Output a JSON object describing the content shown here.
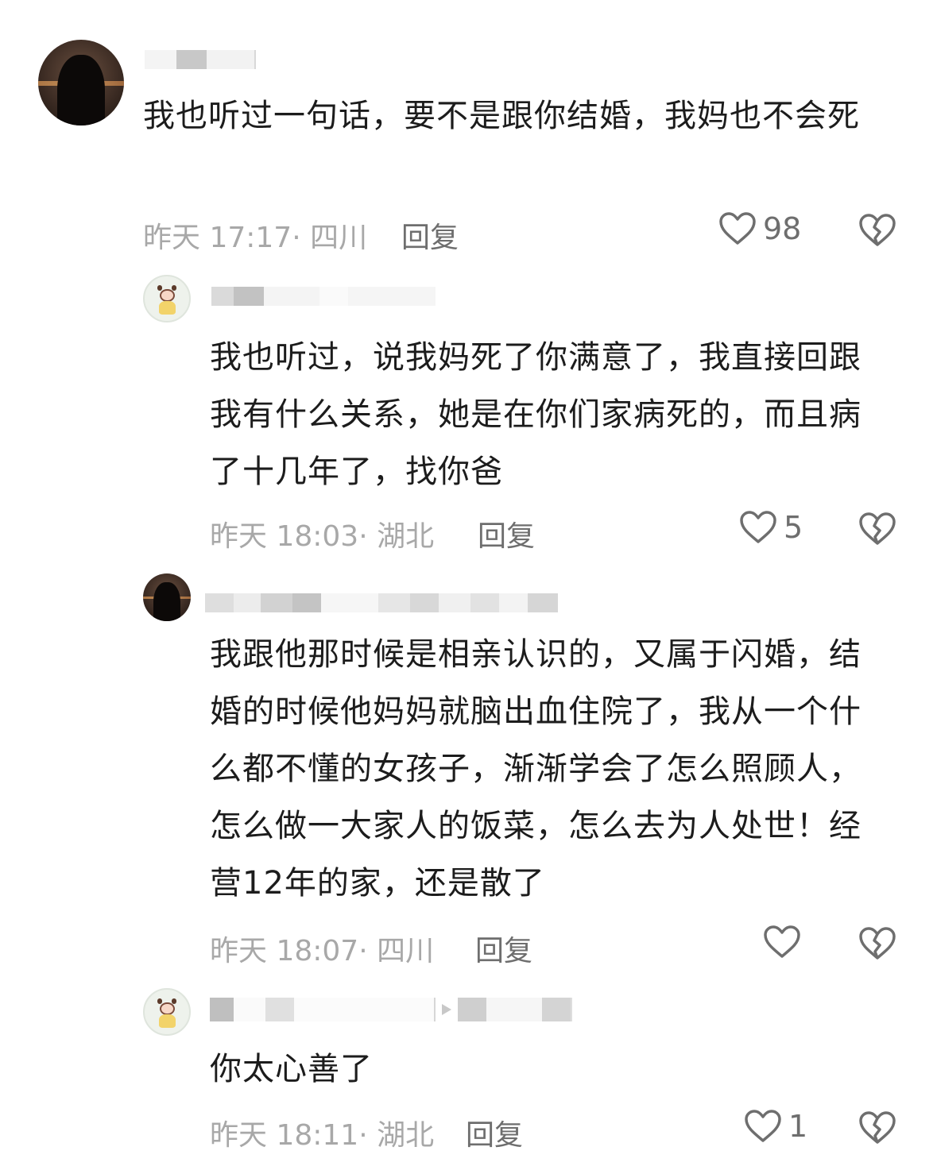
{
  "comments": [
    {
      "text": "我也听过一句话，要不是跟你结婚，我妈也不会死",
      "time": "昨天 17:17",
      "location": "四川",
      "reply_label": "回复",
      "likes": "98"
    },
    {
      "text": "我也听过，说我妈死了你满意了，我直接回跟我有什么关系，她是在你们家病死的，而且病了十几年了，找你爸",
      "time": "昨天 18:03",
      "location": "湖北",
      "reply_label": "回复",
      "likes": "5"
    },
    {
      "text": "我跟他那时候是相亲认识的，又属于闪婚，结婚的时候他妈妈就脑出血住院了，我从一个什么都不懂的女孩子，渐渐学会了怎么照顾人，怎么做一大家人的饭菜，怎么去为人处世！经营12年的家，还是散了",
      "time": "昨天 18:07",
      "location": "四川",
      "reply_label": "回复",
      "likes": ""
    },
    {
      "text": "你太心善了",
      "time": "昨天 18:11",
      "location": "湖北",
      "reply_label": "回复",
      "likes": "1"
    }
  ],
  "icons": {
    "like": "heart-outline-icon",
    "dislike": "broken-heart-icon"
  },
  "colors": {
    "text": "#1c1c1c",
    "meta": "#a8a8a8",
    "icon": "#6e6e6e"
  }
}
